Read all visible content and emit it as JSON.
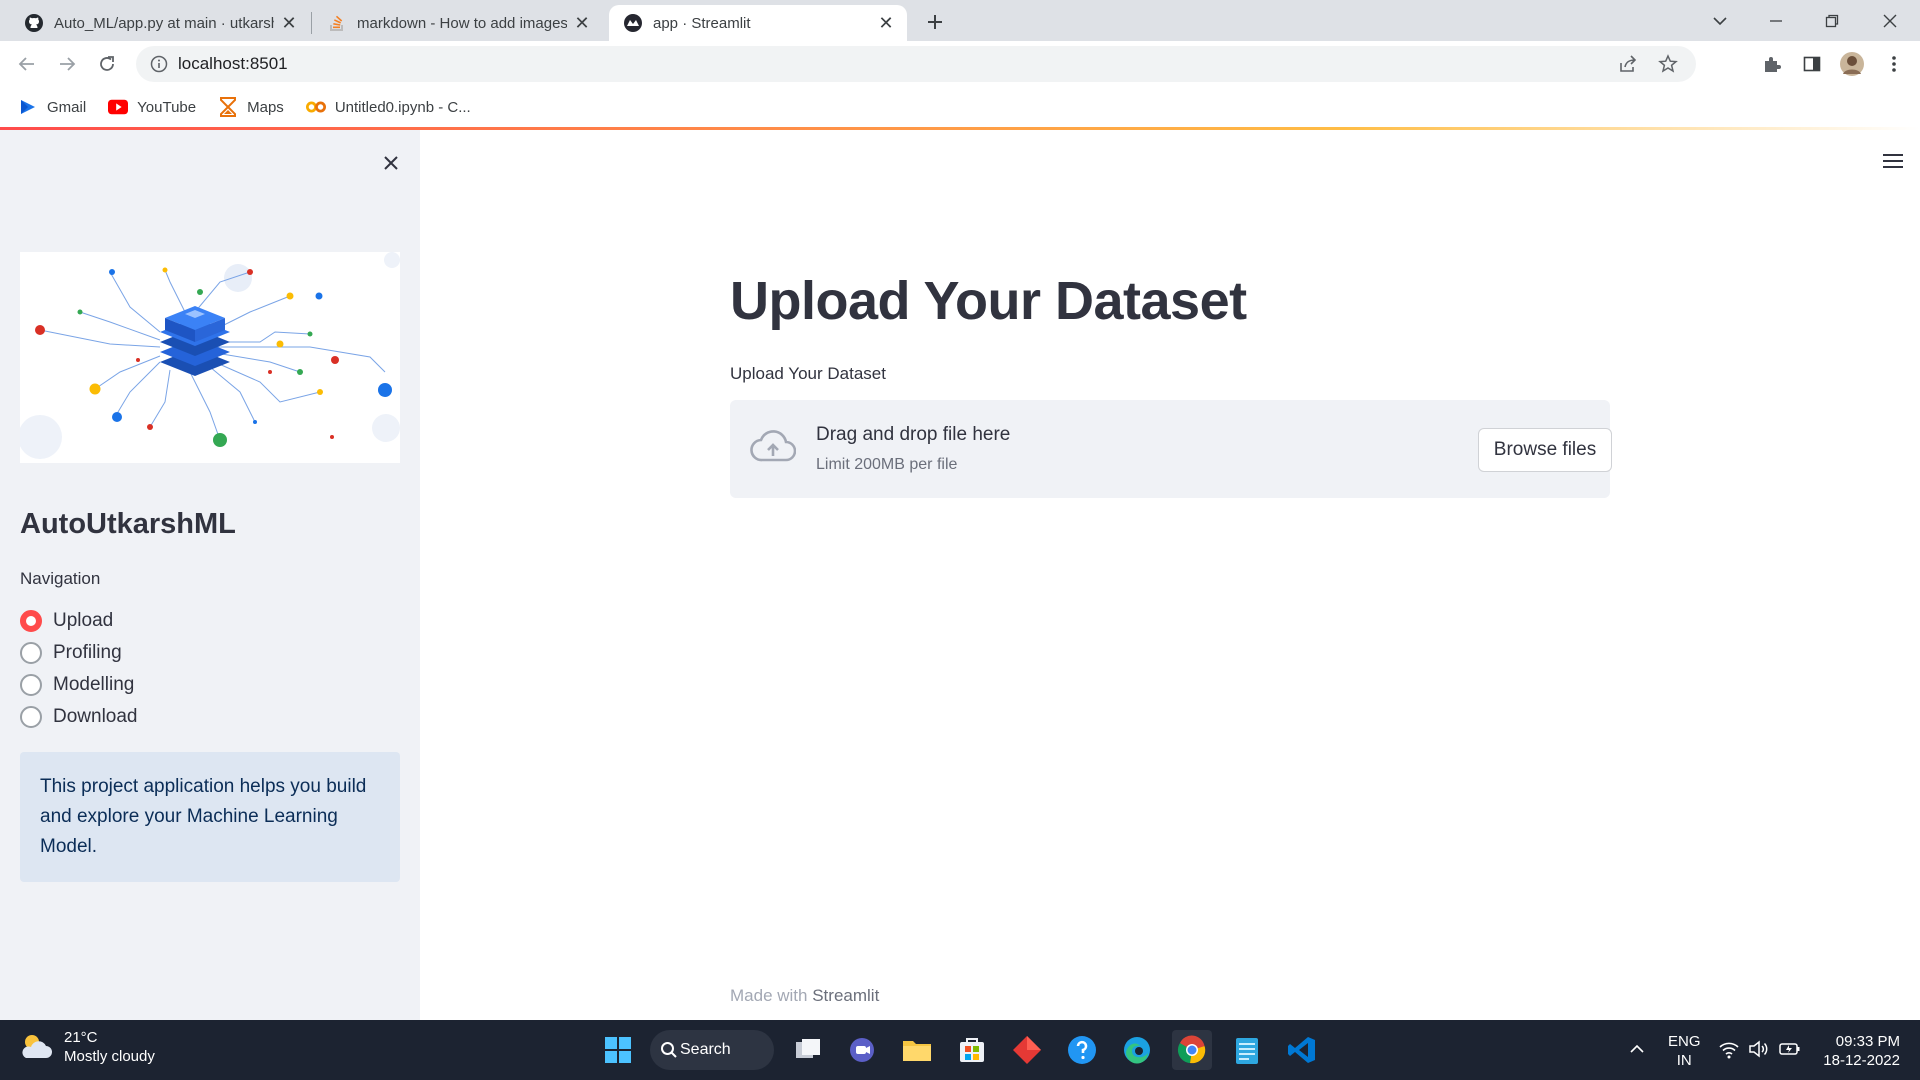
{
  "browser": {
    "tabs": [
      {
        "title": "Auto_ML/app.py at main · utkarsh",
        "icon": "github-icon"
      },
      {
        "title": "markdown - How to add images",
        "icon": "stackoverflow-icon"
      },
      {
        "title": "app · Streamlit",
        "icon": "streamlit-icon",
        "active": true
      }
    ],
    "url": "localhost:8501",
    "bookmarks": [
      {
        "label": "Gmail",
        "icon": "gmail-icon"
      },
      {
        "label": "YouTube",
        "icon": "youtube-icon"
      },
      {
        "label": "Maps",
        "icon": "maps-icon"
      },
      {
        "label": "Untitled0.ipynb - C...",
        "icon": "colab-icon"
      }
    ]
  },
  "sidebar": {
    "title": "AutoUtkarshML",
    "nav_label": "Navigation",
    "options": [
      "Upload",
      "Profiling",
      "Modelling",
      "Download"
    ],
    "selected": "Upload",
    "info_text": "This project application helps you build and explore your Machine Learning Model."
  },
  "main": {
    "title": "Upload Your Dataset",
    "uploader_label": "Upload Your Dataset",
    "dropzone_text": "Drag and drop file here",
    "limit_text": "Limit 200MB per file",
    "browse_label": "Browse files",
    "footer_prefix": "Made with",
    "footer_brand": "Streamlit"
  },
  "taskbar": {
    "temperature": "21°C",
    "weather": "Mostly cloudy",
    "search_label": "Search",
    "lang_top": "ENG",
    "lang_bottom": "IN",
    "time": "09:33 PM",
    "date": "18-12-2022"
  },
  "colors": {
    "streamlit_red": "#ff4b4b",
    "sidebar_bg": "#f0f2f6",
    "info_bg": "#dde6f2",
    "text": "#31333f",
    "taskbar_bg": "#1c2331"
  }
}
